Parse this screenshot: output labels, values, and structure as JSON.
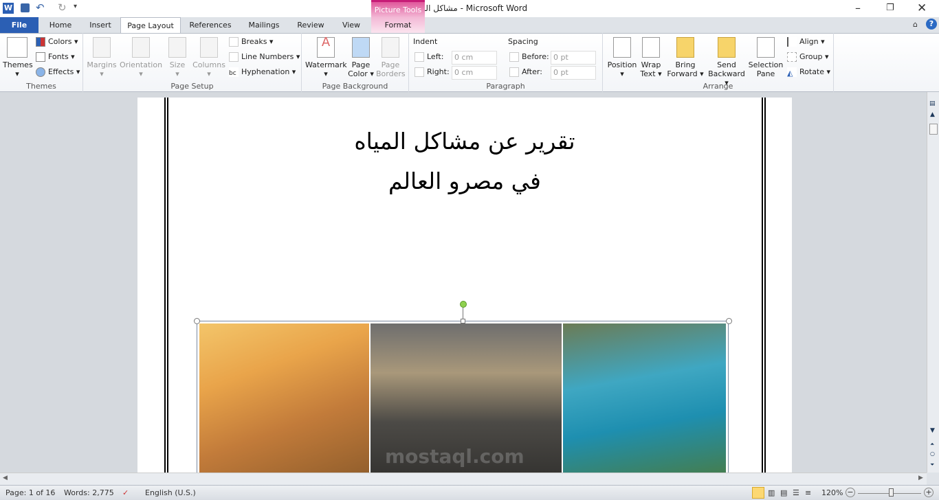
{
  "window": {
    "title": "مشاكل المياه  -  Microsoft Word",
    "contextual_group": "Picture Tools",
    "contextual_tab": "Format"
  },
  "tabs": [
    "File",
    "Home",
    "Insert",
    "Page Layout",
    "References",
    "Mailings",
    "Review",
    "View"
  ],
  "active_tab": "Page Layout",
  "ribbon": {
    "themes": {
      "themes": "Themes",
      "colors": "Colors",
      "fonts": "Fonts",
      "effects": "Effects",
      "label": "Themes"
    },
    "page_setup": {
      "margins": "Margins",
      "orientation": "Orientation",
      "size": "Size",
      "columns": "Columns",
      "breaks": "Breaks",
      "line_numbers": "Line Numbers",
      "hyphenation": "Hyphenation",
      "label": "Page Setup"
    },
    "page_background": {
      "watermark": "Watermark",
      "page_color_1": "Page",
      "page_color_2": "Color",
      "page_borders_1": "Page",
      "page_borders_2": "Borders",
      "label": "Page Background"
    },
    "paragraph": {
      "indent": "Indent",
      "left": "Left:",
      "left_value": "0 cm",
      "right": "Right:",
      "right_value": "0 cm",
      "spacing": "Spacing",
      "before": "Before:",
      "before_value": "0 pt",
      "after": "After:",
      "after_value": "0 pt",
      "label": "Paragraph"
    },
    "arrange": {
      "position": "Position",
      "wrap_1": "Wrap",
      "wrap_2": "Text",
      "bring_1": "Bring",
      "bring_2": "Forward",
      "send_1": "Send",
      "send_2": "Backward",
      "sel_1": "Selection",
      "sel_2": "Pane",
      "align": "Align",
      "group": "Group",
      "rotate": "Rotate",
      "label": "Arrange"
    }
  },
  "document": {
    "title_line1": "تقرير عن مشاكل المياه",
    "title_line2": "في مصرو العالم"
  },
  "watermark_logo": "mostaql.com",
  "status": {
    "page": "Page: 1 of 16",
    "words": "Words: 2,775",
    "language": "English (U.S.)",
    "zoom": "120%"
  },
  "colors": {
    "file_tab": "#2b5fb4",
    "picture_tools": "#e0579b"
  }
}
